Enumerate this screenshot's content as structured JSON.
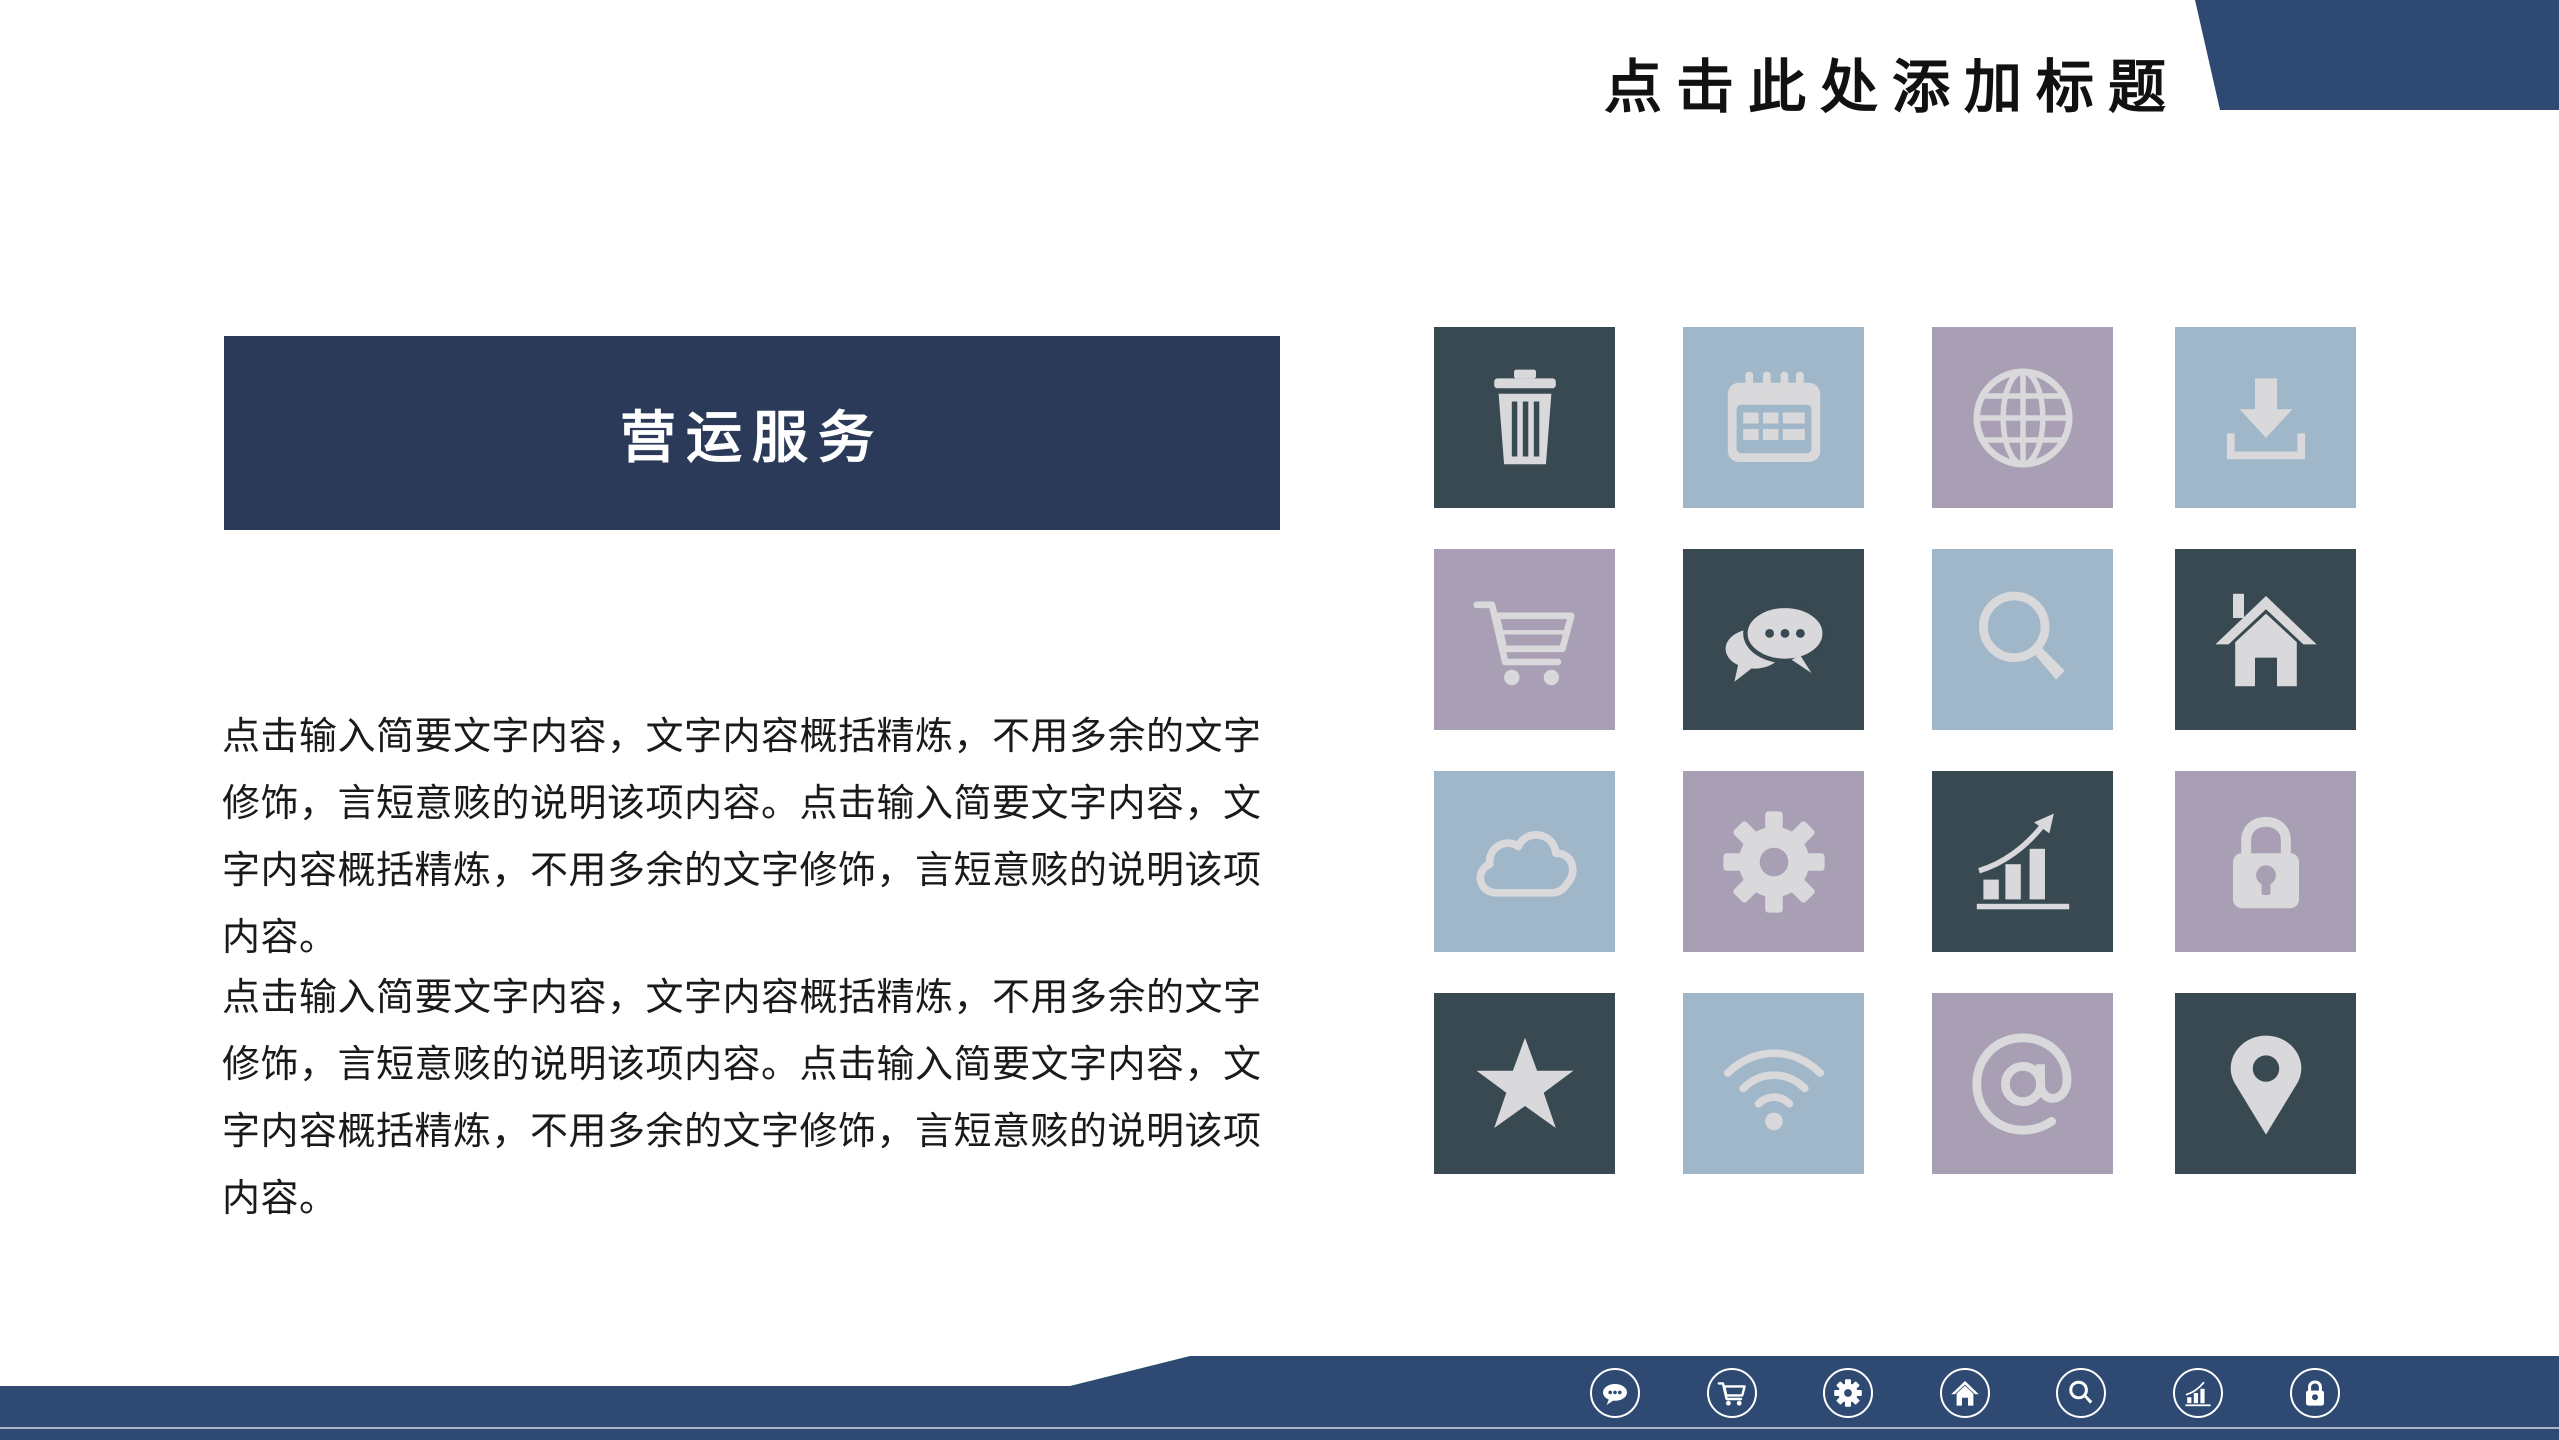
{
  "header": {
    "title": "点击此处添加标题"
  },
  "section": {
    "title": "营运服务"
  },
  "paragraphs": [
    "点击输入简要文字内容，文字内容概括精炼，不用多余的文字修饰，言短意赅的说明该项内容。点击输入简要文字内容，文字内容概括精炼，不用多余的文字修饰，言短意赅的说明该项内容。",
    "点击输入简要文字内容，文字内容概括精炼，不用多余的文字修饰，言短意赅的说明该项内容。点击输入简要文字内容，文字内容概括精炼，不用多余的文字修饰，言短意赅的说明该项内容。"
  ],
  "colors": {
    "navy": "#2b3a59",
    "dark_slate": "#384952",
    "light_blue": "#a0b6c9",
    "lavender": "#a89fb4",
    "icon_fill": "#d9d9db"
  },
  "icon_grid": [
    [
      "trash-icon",
      "calendar-icon",
      "globe-icon",
      "download-icon"
    ],
    [
      "cart-icon",
      "chat-icon",
      "search-icon",
      "home-icon"
    ],
    [
      "cloud-icon",
      "gear-icon",
      "chart-icon",
      "lock-icon"
    ],
    [
      "star-icon",
      "wifi-icon",
      "at-icon",
      "location-pin-icon"
    ]
  ],
  "footer_icons": [
    "chat-icon",
    "cart-icon",
    "gear-icon",
    "home-icon",
    "search-icon",
    "chart-icon",
    "lock-icon"
  ]
}
